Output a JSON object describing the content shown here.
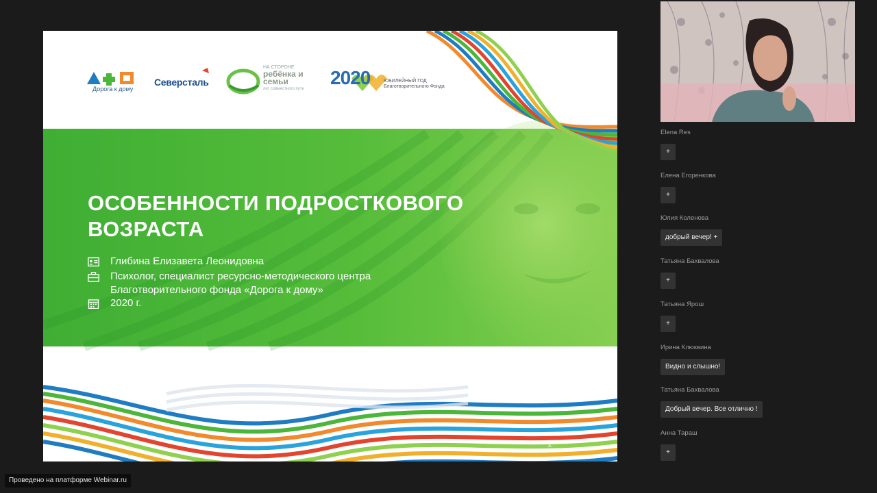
{
  "slide": {
    "logos": {
      "doroga": "Дорога к дому",
      "severstal": "Северсталь",
      "storona_top": "на стороне",
      "storona_main": "ребёнка и семьи",
      "storona_sub": "лет совместного пути",
      "year_2020": "2020",
      "year_caption_1": "Юбилейный год",
      "year_caption_2": "Благотворительного Фонда"
    },
    "title": "ОСОБЕННОСТИ ПОДРОСТКОВОГО ВОЗРАСТА",
    "author": "Глибина Елизавета Леонидовна",
    "position": "Психолог, специалист ресурсно-методического центра Благотворительного фонда «Дорога к дому»",
    "year": "2020 г.",
    "page_number": "1",
    "icons": [
      "id-card-icon",
      "briefcase-icon",
      "calendar-icon"
    ],
    "colors": {
      "green": "#4cb63a",
      "light_green": "#8fd14f",
      "blue": "#1f7cc2",
      "orange": "#f08a2c",
      "red": "#e2452f"
    }
  },
  "participants": [
    {
      "name": "Elena Res",
      "message": "+"
    },
    {
      "name": "Елена Егоренкова",
      "message": "+"
    },
    {
      "name": "Юлия Коленова",
      "message": "добрый вечер! +"
    },
    {
      "name": "Татьяна Бахвалова",
      "message": "+"
    },
    {
      "name": "Татьяна Ярош",
      "message": "+"
    },
    {
      "name": "Ирина Клюквина",
      "message": "Видно и слышно!"
    },
    {
      "name": "Татьяна Бахвалова",
      "message": "Добрый вечер. Все отлично !"
    },
    {
      "name": "Анна Тараш",
      "message": "+"
    }
  ],
  "footer": {
    "platform_label": "Проведено на платформе Webinar.ru"
  }
}
